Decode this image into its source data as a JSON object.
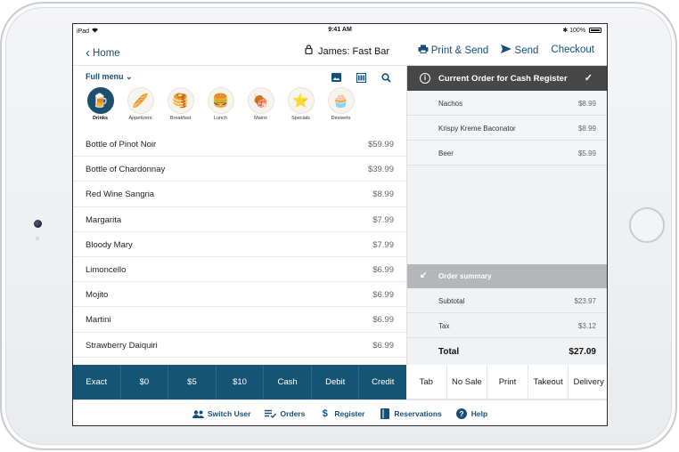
{
  "colors": {
    "accent": "#145079",
    "pay_bar": "#155475",
    "order_header": "#474747",
    "summary_header": "#b4b6b9"
  },
  "status_bar": {
    "carrier": "iPad",
    "time": "9:41 AM",
    "battery": "100%"
  },
  "nav": {
    "back_label": "Home",
    "title": "James: Fast Bar",
    "actions": [
      "Print & Send",
      "Send",
      "Checkout"
    ]
  },
  "menu": {
    "selector_label": "Full menu",
    "tool_icons": [
      "image-icon",
      "barcode-icon",
      "search-icon"
    ],
    "categories": [
      {
        "label": "Drinks",
        "icon": "beer-icon",
        "active": true
      },
      {
        "label": "Appetizers",
        "icon": "bread-icon"
      },
      {
        "label": "Breakfast",
        "icon": "pancakes-icon"
      },
      {
        "label": "Lunch",
        "icon": "burger-icon"
      },
      {
        "label": "Mains",
        "icon": "meat-icon"
      },
      {
        "label": "Specials",
        "icon": "star-icon"
      },
      {
        "label": "Desserts",
        "icon": "cupcake-icon"
      }
    ],
    "items": [
      {
        "name": "Bottle of Pinot Noir",
        "price": "$59.99"
      },
      {
        "name": "Bottle of Chardonnay",
        "price": "$39.99"
      },
      {
        "name": "Red Wine Sangria",
        "price": "$8.99"
      },
      {
        "name": "Margarita",
        "price": "$7.99"
      },
      {
        "name": "Bloody Mary",
        "price": "$7.99"
      },
      {
        "name": "Limoncello",
        "price": "$6.99"
      },
      {
        "name": "Mojito",
        "price": "$6.99"
      },
      {
        "name": "Martini",
        "price": "$6.99"
      },
      {
        "name": "Strawberry Daiquiri",
        "price": "$6.99"
      }
    ]
  },
  "order": {
    "title": "Current Order for Cash Register",
    "lines": [
      {
        "name": "Nachos",
        "price": "$8.99"
      },
      {
        "name": "Krispy Kreme Baconator",
        "price": "$8.99"
      },
      {
        "name": "Beer",
        "price": "$5.99"
      }
    ],
    "summary_title": "Order summary",
    "subtotal_label": "Subtotal",
    "subtotal": "$23.97",
    "tax_label": "Tax",
    "tax": "$3.12",
    "total_label": "Total",
    "total": "$27.09"
  },
  "payment_buttons": [
    "Exact",
    "$0",
    "$5",
    "$10",
    "Cash",
    "Debit",
    "Credit"
  ],
  "action_buttons": [
    "Tab",
    "No Sale",
    "Print",
    "Takeout",
    "Delivery"
  ],
  "tabbar": [
    {
      "label": "Switch User",
      "icon": "users-icon"
    },
    {
      "label": "Orders",
      "icon": "list-check-icon"
    },
    {
      "label": "Register",
      "icon": "dollar-icon"
    },
    {
      "label": "Reservations",
      "icon": "book-icon"
    },
    {
      "label": "Help",
      "icon": "help-icon"
    }
  ]
}
